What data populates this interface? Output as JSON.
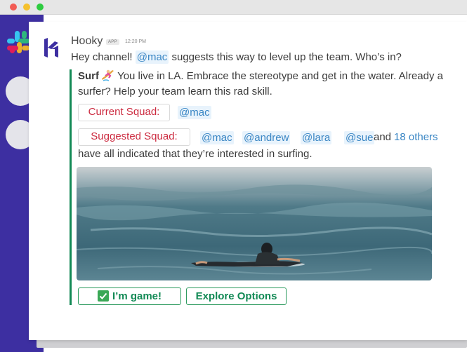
{
  "window": {
    "controls": [
      "close",
      "minimize",
      "zoom"
    ]
  },
  "sidebar": {
    "logo_icon": "slack-logo-icon",
    "workspaces": [
      "workspace-1",
      "workspace-2"
    ]
  },
  "message": {
    "sender": "Hooky",
    "badge": "APP",
    "time": "12:20 PM",
    "text_prefix": "Hey channel! ",
    "mention": "@mac",
    "text_suffix": " suggests this way to level up the team. Who’s in?"
  },
  "attachment": {
    "title": "Surf",
    "emoji": "surfer-emoji",
    "description": "You live in LA. Embrace the stereotype and get in the water. Already a surfer? Help your team learn this rad skill.",
    "current_squad_label": "Current Squad:",
    "current_squad": [
      "@mac"
    ],
    "suggested_squad_label": "Suggested Squad:",
    "suggested_squad": [
      "@mac",
      "@andrew",
      "@lara",
      "@sue"
    ],
    "and_text": "and",
    "others_link": "18 others",
    "indicated_text": "have all indicated that they’re interested in surfing.",
    "image_icon": "surfer-photo"
  },
  "buttons": {
    "game_label": "I’m game!",
    "explore_label": "Explore Options"
  },
  "colors": {
    "sidebar": "#3d2fa1",
    "accent_green": "#138a56",
    "mention_blue": "#3a86c4",
    "label_red": "#cc2b40"
  }
}
